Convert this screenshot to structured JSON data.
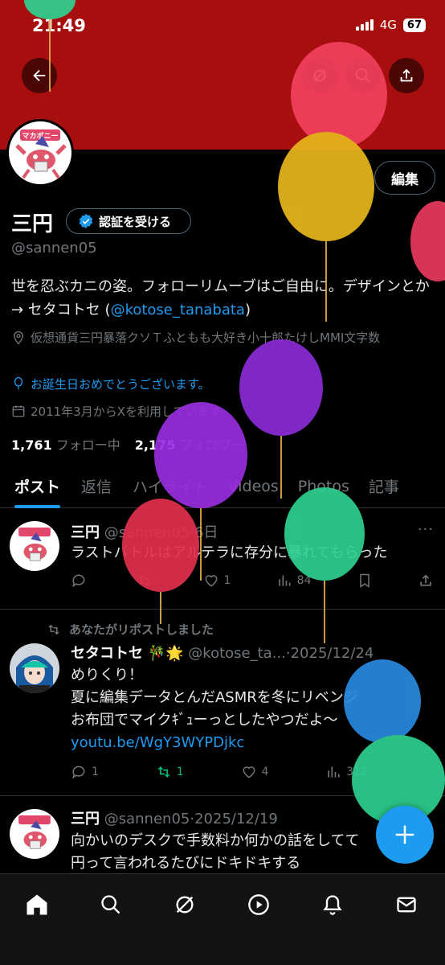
{
  "status": {
    "time": "21:49",
    "network": "4G",
    "battery": "67"
  },
  "profile": {
    "display_name": "三円",
    "verify_label": "認証を受ける",
    "handle": "@sannen05",
    "edit_label": "編集",
    "bio_text": "世を忍ぶカニの姿。フォローリムーブはご自由に。デザインとか → セタコトセ (",
    "bio_link": "@kotose_tanabata",
    "bio_end": ")",
    "location": "仮想通貨三円暴落クソＴふともも大好き小十郎たけしMMI文字数",
    "birthday": "お誕生日おめでとうございます。",
    "joined": "2011年3月からXを利用しています",
    "following_count": "1,761",
    "following_label": "フォロー中",
    "followers_count": "2,175",
    "followers_label": "フォロワー"
  },
  "tabs": [
    "ポスト",
    "返信",
    "ハイライト",
    "Videos",
    "Photos",
    "記事"
  ],
  "posts": [
    {
      "name": "三円",
      "handle": "@sannen05",
      "time": "6日",
      "text": "ラストバトルはアルテラに存分に暴れてもらった",
      "replies": "",
      "reposts": "",
      "likes": "1",
      "views": "84"
    },
    {
      "repost_banner": "あなたがリポストしました",
      "name": "セタコトセ",
      "badge": "🎋🌟",
      "handle": "@kotose_ta...",
      "time": "2025/12/24",
      "text_lines": [
        "めりくり！",
        "夏に編集データとんだASMRを冬にリベンジ",
        "お布団でマイクｷﾞｭーっとしたやつだよ〜"
      ],
      "link": "youtu.be/WgY3WYPDjkc",
      "replies": "1",
      "reposts": "1",
      "likes": "4",
      "views": "312"
    },
    {
      "name": "三円",
      "handle": "@sannen05",
      "time": "2025/12/19",
      "text_lines": [
        "向かいのデスクで手数料か何かの話をしてて",
        "円って言われるたびにドキドキする"
      ]
    }
  ],
  "avatar_text": "マカボニー",
  "icons": {
    "back": "arrow-left",
    "grok": "grok",
    "search": "search",
    "share": "share",
    "verified": "verified-badge",
    "location": "location-pin",
    "birthday": "balloon",
    "calendar": "calendar",
    "home": "home",
    "explore": "search",
    "grok_nav": "grok",
    "video": "play",
    "notifications": "bell",
    "messages": "envelope",
    "compose": "plus"
  },
  "colors": {
    "accent": "#1d9bf0",
    "banner": "#a70e0e",
    "repost_green": "#00ba7c"
  }
}
